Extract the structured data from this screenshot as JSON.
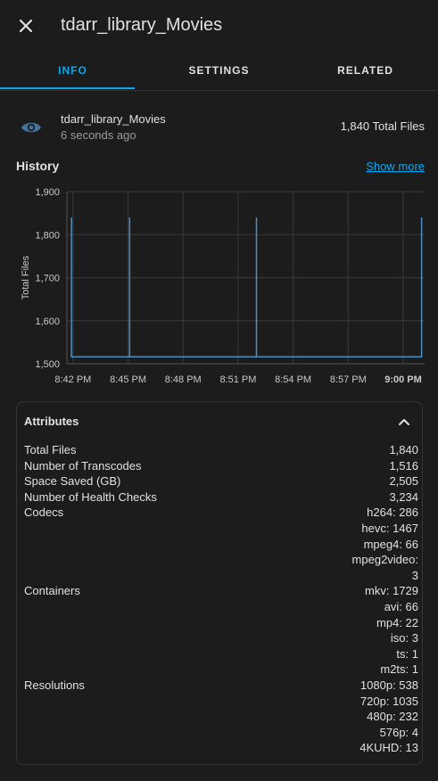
{
  "dialog": {
    "title": "tdarr_library_Movies"
  },
  "tabs": [
    {
      "label": "INFO",
      "active": true
    },
    {
      "label": "SETTINGS",
      "active": false
    },
    {
      "label": "RELATED",
      "active": false
    }
  ],
  "entity": {
    "icon": "eye-icon",
    "name": "tdarr_library_Movies",
    "last_changed": "6 seconds ago",
    "state": "1,840 Total Files"
  },
  "history": {
    "title": "History",
    "show_more": "Show more"
  },
  "chart_data": {
    "type": "line",
    "ylabel": "Total Files",
    "ylim": [
      1500,
      1900
    ],
    "yticks": [
      "1,500",
      "1,600",
      "1,700",
      "1,800",
      "1,900"
    ],
    "xticks": [
      "8:42 PM",
      "8:45 PM",
      "8:48 PM",
      "8:51 PM",
      "8:54 PM",
      "8:57 PM",
      "9:00 PM"
    ],
    "series": [
      {
        "color": "#4a8fc8",
        "points": [
          [
            "8:41:55",
            1840
          ],
          [
            "8:41:55",
            1516
          ],
          [
            "8:45:05",
            1516
          ],
          [
            "8:45:05",
            1840
          ],
          [
            "8:45:05",
            1516
          ],
          [
            "8:52:00",
            1516
          ],
          [
            "8:52:00",
            1840
          ],
          [
            "8:52:00",
            1516
          ],
          [
            "9:01:00",
            1516
          ],
          [
            "9:01:00",
            1840
          ]
        ]
      }
    ],
    "line_color": "#4a8fc8",
    "grid": true
  },
  "attributes": {
    "title": "Attributes",
    "rows": [
      {
        "key": "Total Files",
        "values": [
          "1,840"
        ]
      },
      {
        "key": "Number of Transcodes",
        "values": [
          "1,516"
        ]
      },
      {
        "key": "Space Saved (GB)",
        "values": [
          "2,505"
        ]
      },
      {
        "key": "Number of Health Checks",
        "values": [
          "3,234"
        ]
      },
      {
        "key": "Codecs",
        "values": [
          "h264: 286",
          "hevc: 1467",
          "mpeg4: 66",
          "mpeg2video:",
          "3"
        ]
      },
      {
        "key": "Containers",
        "values": [
          "mkv: 1729",
          "avi: 66",
          "mp4: 22",
          "iso: 3",
          "ts: 1",
          "m2ts: 1"
        ]
      },
      {
        "key": "Resolutions",
        "values": [
          "1080p: 538",
          "720p: 1035",
          "480p: 232",
          "576p: 4",
          "4KUHD: 13"
        ]
      }
    ]
  },
  "colors": {
    "accent": "#03a9f4",
    "background": "#1c1c1c",
    "icon": "#44739e"
  }
}
